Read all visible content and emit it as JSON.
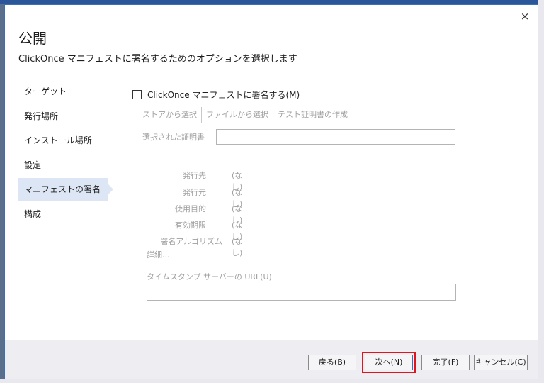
{
  "dialog": {
    "title": "公開",
    "subtitle": "ClickOnce マニフェストに署名するためのオプションを選択します",
    "close_label": "×"
  },
  "nav": {
    "items": [
      {
        "label": "ターゲット",
        "active": false
      },
      {
        "label": "発行場所",
        "active": false
      },
      {
        "label": "インストール場所",
        "active": false
      },
      {
        "label": "設定",
        "active": false
      },
      {
        "label": "マニフェストの署名",
        "active": true
      },
      {
        "label": "構成",
        "active": false
      }
    ]
  },
  "signing": {
    "checkbox_label": "ClickOnce マニフェストに署名する(M)",
    "checked": false,
    "toolbar": {
      "from_store": "ストアから選択",
      "from_file": "ファイルから選択",
      "test_cert": "テスト証明書の作成"
    },
    "selected_cert_label": "選択された証明書",
    "selected_cert_value": "",
    "info": [
      {
        "key": "発行先",
        "value": "(なし)"
      },
      {
        "key": "発行元",
        "value": "(なし)"
      },
      {
        "key": "使用目的",
        "value": "(なし)"
      },
      {
        "key": "有効期限",
        "value": "(なし)"
      },
      {
        "key": "署名アルゴリズム",
        "value": "(なし)"
      }
    ],
    "details_link": "詳細...",
    "timestamp_label": "タイムスタンプ サーバーの URL(U)",
    "timestamp_value": ""
  },
  "footer": {
    "back": "戻る(B)",
    "next": "次へ(N)",
    "finish": "完了(F)",
    "cancel": "キャンセル(C)"
  },
  "colors": {
    "accent": "#3c6fb4",
    "highlight": "#e0141e",
    "nav_active_bg": "#dce6f4",
    "disabled_text": "#a0a0a0"
  }
}
